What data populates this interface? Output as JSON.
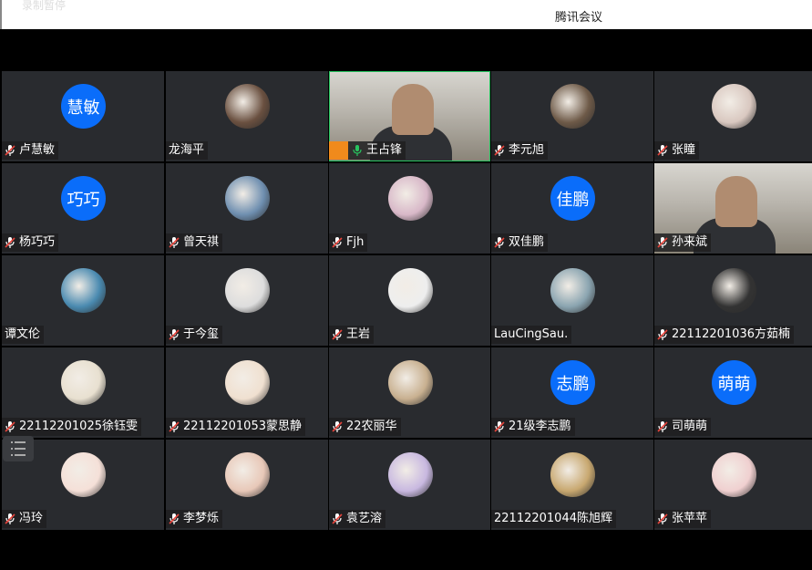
{
  "window": {
    "title": "腾讯会议"
  },
  "recording": {
    "status": "录制暂停"
  },
  "participants": [
    {
      "name": "卢慧敏",
      "avatar_text": "慧敏",
      "mic": "muted"
    },
    {
      "name": "龙海平",
      "avatar_text": "",
      "mic": "none"
    },
    {
      "name": "王占锋",
      "avatar_text": "",
      "mic": "on",
      "video": true,
      "host": true
    },
    {
      "name": "李元旭",
      "avatar_text": "",
      "mic": "muted"
    },
    {
      "name": "张瞳",
      "avatar_text": "",
      "mic": "muted"
    },
    {
      "name": "杨巧巧",
      "avatar_text": "巧巧",
      "mic": "muted"
    },
    {
      "name": "曾天祺",
      "avatar_text": "",
      "mic": "muted"
    },
    {
      "name": "Fjh",
      "avatar_text": "",
      "mic": "muted"
    },
    {
      "name": "双佳鹏",
      "avatar_text": "佳鹏",
      "mic": "muted"
    },
    {
      "name": "孙来斌",
      "avatar_text": "",
      "mic": "muted",
      "video": true
    },
    {
      "name": "谭文伦",
      "avatar_text": "",
      "mic": "none"
    },
    {
      "name": "于今玺",
      "avatar_text": "",
      "mic": "muted"
    },
    {
      "name": "王岩",
      "avatar_text": "",
      "mic": "muted"
    },
    {
      "name": "LauCingSau.",
      "avatar_text": "",
      "mic": "none"
    },
    {
      "name": "22112201036方茹楠",
      "avatar_text": "",
      "mic": "muted"
    },
    {
      "name": "22112201025徐钰雯",
      "avatar_text": "",
      "mic": "muted"
    },
    {
      "name": "22112201053蒙思静",
      "avatar_text": "",
      "mic": "muted"
    },
    {
      "name": "22农丽华",
      "avatar_text": "",
      "mic": "muted"
    },
    {
      "name": "21级李志鹏",
      "avatar_text": "志鹏",
      "mic": "muted"
    },
    {
      "name": "司萌萌",
      "avatar_text": "萌萌",
      "mic": "muted"
    },
    {
      "name": "冯玲",
      "avatar_text": "",
      "mic": "muted"
    },
    {
      "name": "李梦烁",
      "avatar_text": "",
      "mic": "muted"
    },
    {
      "name": "袁艺溶",
      "avatar_text": "",
      "mic": "muted"
    },
    {
      "name": "22112201044陈旭辉",
      "avatar_text": "",
      "mic": "none"
    },
    {
      "name": "张苹苹",
      "avatar_text": "",
      "mic": "muted"
    }
  ],
  "colors": {
    "avatar_blue": "#0a6dfa",
    "tile_bg": "#292b2f",
    "host_orange": "#f08a1c",
    "active_speaker": "#27c45f"
  }
}
